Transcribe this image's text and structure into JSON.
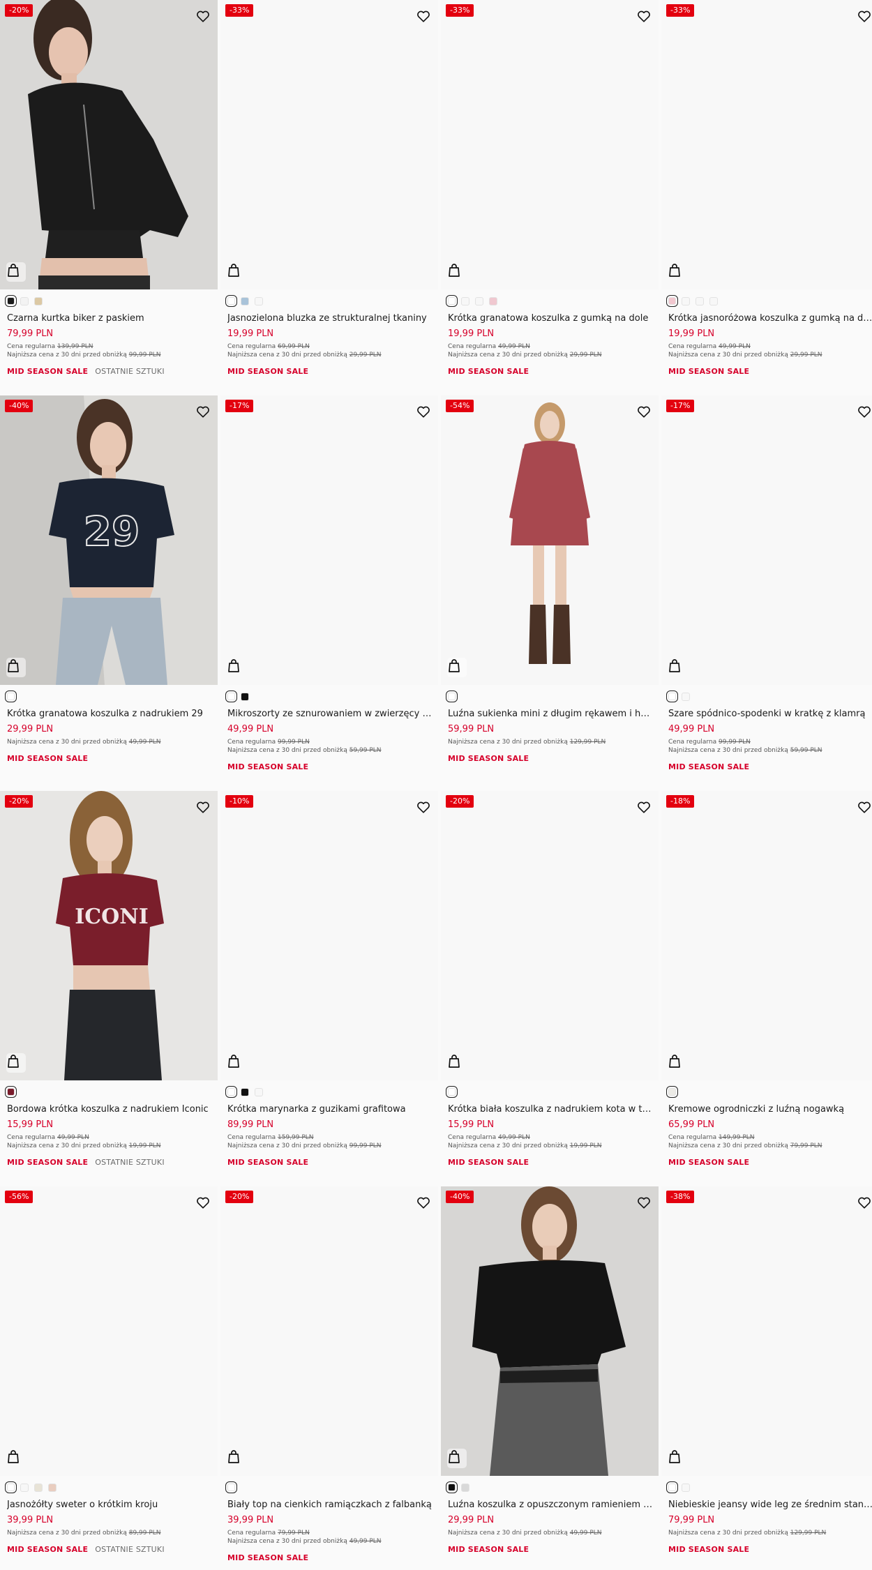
{
  "colors": {
    "accent_red": "#d6002a",
    "badge_red": "#e3000f"
  },
  "icons": {
    "wishlist": "heart-icon",
    "add_to_bag": "shopping-bag-icon"
  },
  "products": [
    {
      "badge": "-20%",
      "has_photo": true,
      "photo": "woman-black-leather-biker-jacket",
      "swatches": [
        "#1a1a1a",
        "#f3f3f3",
        "#dcc9a4"
      ],
      "selected": 0,
      "name": "Czarna kurtka biker z paskiem",
      "price": "79,99 PLN",
      "regular_label": "Cena regularna",
      "regular_price": "139,99 PLN",
      "lowest_label": "Najniższa cena z 30 dni przed obniżką",
      "lowest_price": "99,99 PLN",
      "tags": [
        "MID SEASON SALE",
        "OSTATNIE SZTUKI"
      ]
    },
    {
      "badge": "-33%",
      "has_photo": false,
      "swatches": [
        "#ffffff",
        "#a9c3d9",
        "#f7f7f7"
      ],
      "selected": 0,
      "name": "Jasnozielona bluzka ze strukturalnej tkaniny",
      "price": "19,99 PLN",
      "regular_label": "Cena regularna",
      "regular_price": "69,99 PLN",
      "lowest_label": "Najniższa cena z 30 dni przed obniżką",
      "lowest_price": "29,99 PLN",
      "tags": [
        "MID SEASON SALE"
      ]
    },
    {
      "badge": "-33%",
      "has_photo": false,
      "swatches": [
        "#ffffff",
        "#f7f7f7",
        "#f7f7f7",
        "#f0c8d0"
      ],
      "selected": 0,
      "name": "Krótka granatowa koszulka z gumką na dole",
      "price": "19,99 PLN",
      "regular_label": "Cena regularna",
      "regular_price": "49,99 PLN",
      "lowest_label": "Najniższa cena z 30 dni przed obniżką",
      "lowest_price": "29,99 PLN",
      "tags": [
        "MID SEASON SALE"
      ]
    },
    {
      "badge": "-33%",
      "has_photo": false,
      "swatches": [
        "#f2c7cf",
        "#f7f7f7",
        "#f7f7f7",
        "#f7f7f7"
      ],
      "selected": 0,
      "name": "Krótka jasnoróżowa koszulka z gumką na dole",
      "price": "19,99 PLN",
      "regular_label": "Cena regularna",
      "regular_price": "49,99 PLN",
      "lowest_label": "Najniższa cena z 30 dni przed obniżką",
      "lowest_price": "29,99 PLN",
      "tags": [
        "MID SEASON SALE"
      ]
    },
    {
      "badge": "-40%",
      "has_photo": true,
      "photo": "woman-navy-tee-29-jeans",
      "swatches": [
        "#ffffff"
      ],
      "selected": 0,
      "name": "Krótka granatowa koszulka z nadrukiem 29",
      "price": "29,99 PLN",
      "regular_label": "",
      "regular_price": "",
      "lowest_label": "Najniższa cena z 30 dni przed obniżką",
      "lowest_price": "49,99 PLN",
      "tags": [
        "MID SEASON SALE"
      ]
    },
    {
      "badge": "-17%",
      "has_photo": false,
      "swatches": [
        "#ffffff",
        "#111111"
      ],
      "selected": 0,
      "name": "Mikroszorty ze sznurowaniem w zwierzęcy wzór",
      "price": "49,99 PLN",
      "regular_label": "Cena regularna",
      "regular_price": "99,99 PLN",
      "lowest_label": "Najniższa cena z 30 dni przed obniżką",
      "lowest_price": "59,99 PLN",
      "tags": [
        "MID SEASON SALE"
      ]
    },
    {
      "badge": "-54%",
      "has_photo": true,
      "photo": "woman-red-mini-dress-boots",
      "swatches": [
        "#ffffff"
      ],
      "selected": 0,
      "name": "Luźna sukienka mini z długim rękawem i haftem",
      "price": "59,99 PLN",
      "regular_label": "",
      "regular_price": "",
      "lowest_label": "Najniższa cena z 30 dni przed obniżką",
      "lowest_price": "129,99 PLN",
      "tags": [
        "MID SEASON SALE"
      ]
    },
    {
      "badge": "-17%",
      "has_photo": false,
      "swatches": [
        "#ffffff",
        "#f7f7f7"
      ],
      "selected": 0,
      "name": "Szare spódnico-spodenki w kratkę z klamrą",
      "price": "49,99 PLN",
      "regular_label": "Cena regularna",
      "regular_price": "99,99 PLN",
      "lowest_label": "Najniższa cena z 30 dni przed obniżką",
      "lowest_price": "59,99 PLN",
      "tags": [
        "MID SEASON SALE"
      ]
    },
    {
      "badge": "-20%",
      "has_photo": true,
      "photo": "woman-burgundy-iconic-crop-tee",
      "swatches": [
        "#7a1c2b"
      ],
      "selected": 0,
      "name": "Bordowa krótka koszulka z nadrukiem Iconic",
      "price": "15,99 PLN",
      "regular_label": "Cena regularna",
      "regular_price": "49,99 PLN",
      "lowest_label": "Najniższa cena z 30 dni przed obniżką",
      "lowest_price": "19,99 PLN",
      "tags": [
        "MID SEASON SALE",
        "OSTATNIE SZTUKI"
      ]
    },
    {
      "badge": "-10%",
      "has_photo": false,
      "swatches": [
        "#ffffff",
        "#111111",
        "#f7f7f7"
      ],
      "selected": 0,
      "name": "Krótka marynarka z guzikami grafitowa",
      "price": "89,99 PLN",
      "regular_label": "Cena regularna",
      "regular_price": "159,99 PLN",
      "lowest_label": "Najniższa cena z 30 dni przed obniżką",
      "lowest_price": "99,99 PLN",
      "tags": [
        "MID SEASON SALE"
      ]
    },
    {
      "badge": "-20%",
      "has_photo": false,
      "swatches": [
        "#ffffff"
      ],
      "selected": 0,
      "name": "Krótka biała koszulka z nadrukiem kota w trampkach",
      "price": "15,99 PLN",
      "regular_label": "Cena regularna",
      "regular_price": "49,99 PLN",
      "lowest_label": "Najniższa cena z 30 dni przed obniżką",
      "lowest_price": "19,99 PLN",
      "tags": [
        "MID SEASON SALE"
      ]
    },
    {
      "badge": "-18%",
      "has_photo": false,
      "swatches": [
        "#ecebe6"
      ],
      "selected": 0,
      "name": "Kremowe ogrodniczki z luźną nogawką",
      "price": "65,99 PLN",
      "regular_label": "Cena regularna",
      "regular_price": "149,99 PLN",
      "lowest_label": "Najniższa cena z 30 dni przed obniżką",
      "lowest_price": "79,99 PLN",
      "tags": [
        "MID SEASON SALE"
      ]
    },
    {
      "badge": "-56%",
      "has_photo": false,
      "swatches": [
        "#ffffff",
        "#f7f7f7",
        "#e8e3d6",
        "#e9cdbf"
      ],
      "selected": 0,
      "name": "Jasnożółty sweter o krótkim kroju",
      "price": "39,99 PLN",
      "regular_label": "",
      "regular_price": "",
      "lowest_label": "Najniższa cena z 30 dni przed obniżką",
      "lowest_price": "89,99 PLN",
      "tags": [
        "MID SEASON SALE",
        "OSTATNIE SZTUKI"
      ]
    },
    {
      "badge": "-20%",
      "has_photo": false,
      "swatches": [
        "#ffffff"
      ],
      "selected": 0,
      "name": "Biały top na cienkich ramiączkach z falbanką",
      "price": "39,99 PLN",
      "regular_label": "Cena regularna",
      "regular_price": "79,99 PLN",
      "lowest_label": "Najniższa cena z 30 dni przed obniżką",
      "lowest_price": "49,99 PLN",
      "tags": [
        "MID SEASON SALE"
      ]
    },
    {
      "badge": "-40%",
      "has_photo": true,
      "photo": "woman-black-off-shoulder-tee",
      "swatches": [
        "#111111",
        "#d9d9d9"
      ],
      "selected": 0,
      "name": "Luźna koszulka z opuszczonym ramieniem czarna",
      "price": "29,99 PLN",
      "regular_label": "",
      "regular_price": "",
      "lowest_label": "Najniższa cena z 30 dni przed obniżką",
      "lowest_price": "49,99 PLN",
      "tags": [
        "MID SEASON SALE"
      ]
    },
    {
      "badge": "-38%",
      "has_photo": false,
      "swatches": [
        "#ffffff",
        "#f7f7f7"
      ],
      "selected": 0,
      "name": "Niebieskie jeansy wide leg ze średnim stanem",
      "price": "79,99 PLN",
      "regular_label": "",
      "regular_price": "",
      "lowest_label": "Najniższa cena z 30 dni przed obniżką",
      "lowest_price": "129,99 PLN",
      "tags": [
        "MID SEASON SALE"
      ]
    }
  ]
}
